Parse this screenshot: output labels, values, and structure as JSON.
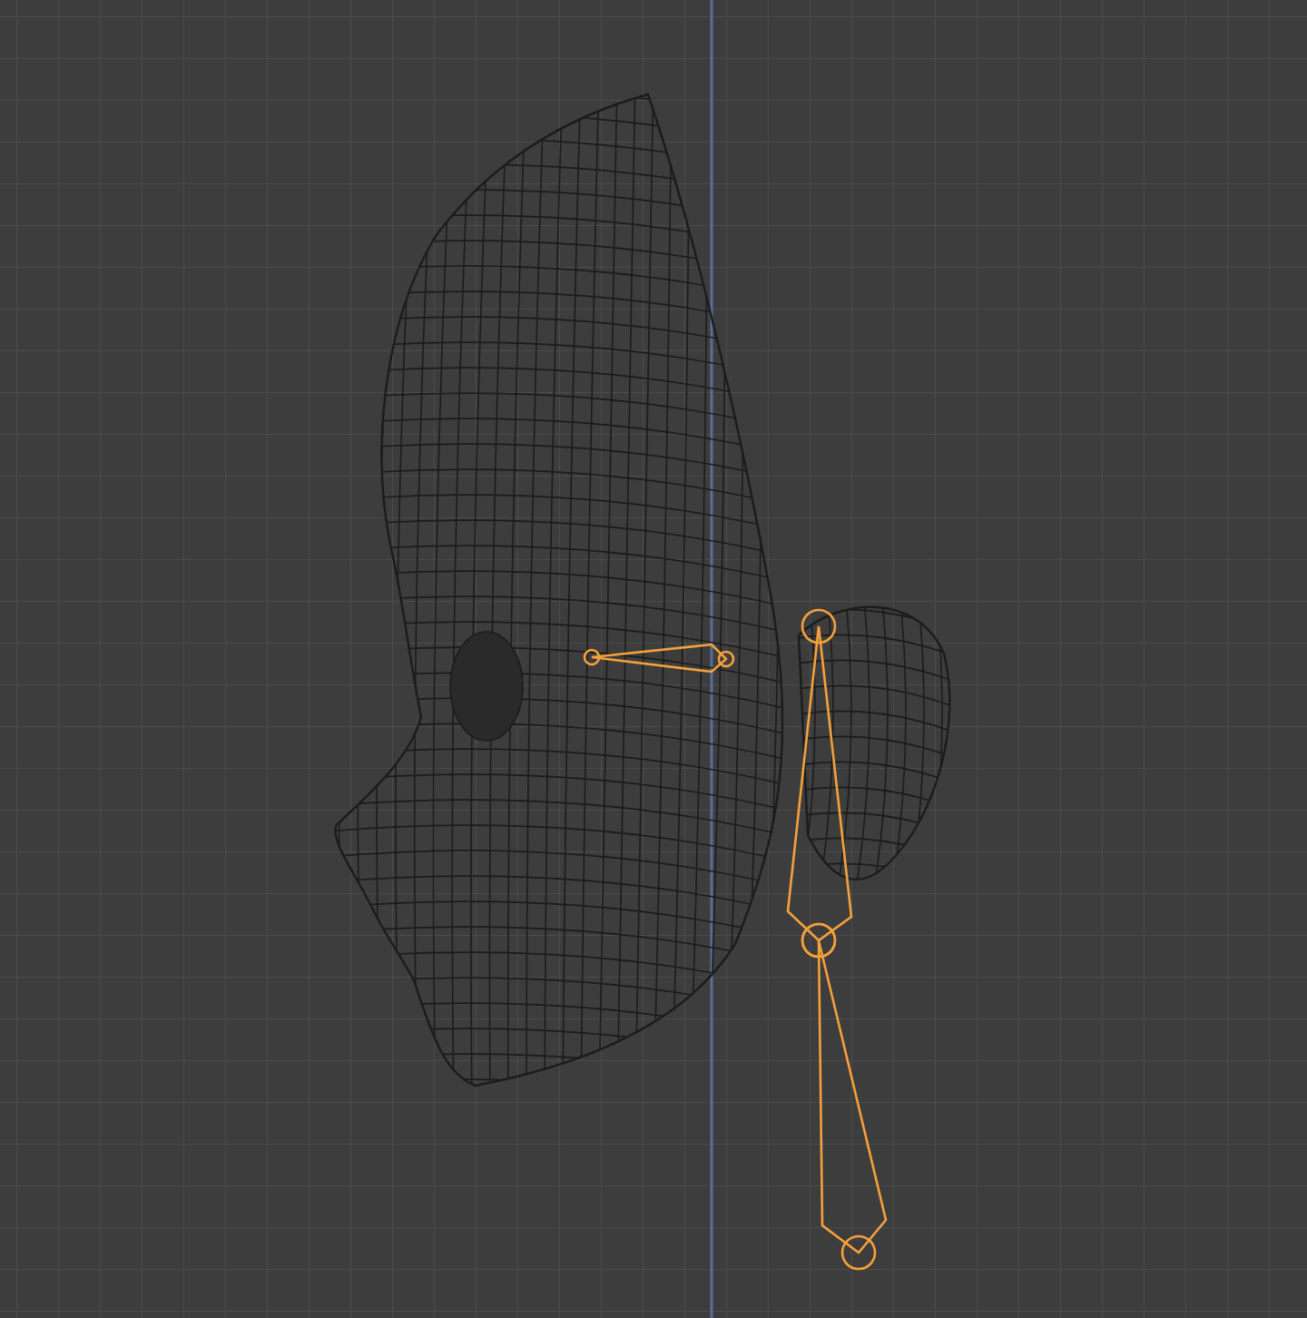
{
  "viewport": {
    "mesh": {
      "selected": false
    },
    "bones": [
      {
        "selected": true
      },
      {
        "selected": true
      },
      {
        "selected": true
      }
    ]
  }
}
